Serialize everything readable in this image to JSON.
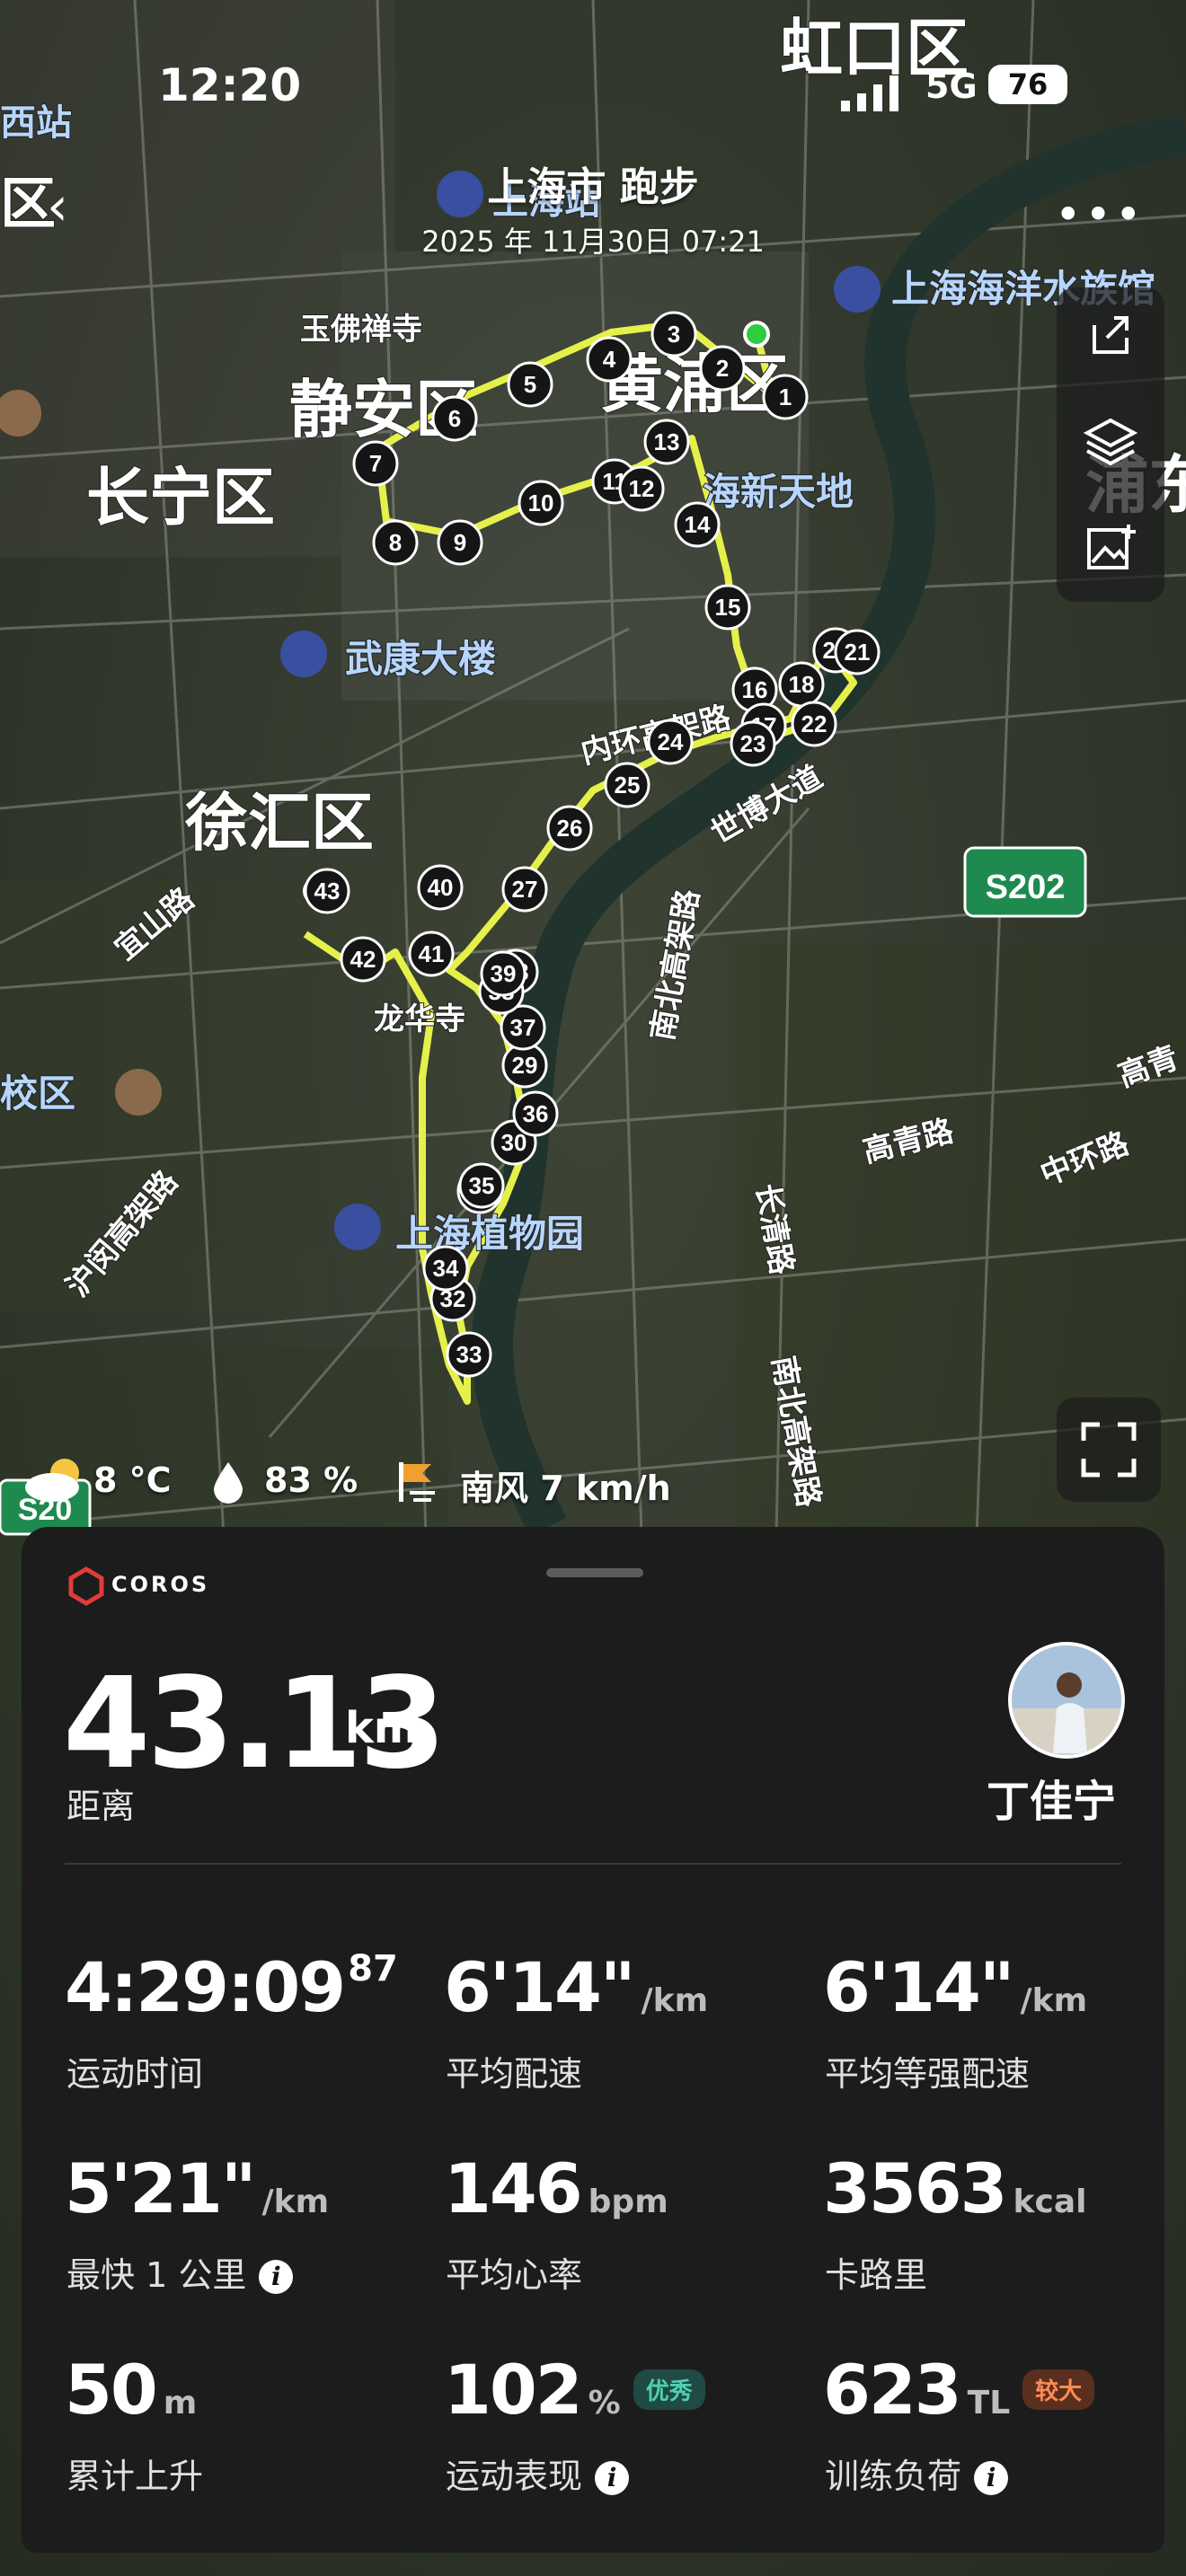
{
  "status_bar": {
    "time": "12:20",
    "network": "5G",
    "battery": "76"
  },
  "header": {
    "title": "上海市 跑步",
    "datetime": "2025 年 11月30日 07:21"
  },
  "map": {
    "labels": [
      "虹口区",
      "西站",
      "区",
      "玉佛禅寺",
      "上海站",
      "上海海洋水族馆",
      "静安区",
      "黄浦区",
      "长宁区",
      "海新天地",
      "武康大楼",
      "内环高架路",
      "徐汇区",
      "宜山路",
      "世博大道",
      "S202",
      "龙华寺",
      "校区",
      "南北高架路",
      "长清路",
      "高青路",
      "中环路",
      "沪闵高架路",
      "上海植物园",
      "南北高架路",
      "S20",
      "浦东",
      "高青"
    ],
    "km_markers": [
      "1",
      "2",
      "3",
      "4",
      "5",
      "6",
      "7",
      "8",
      "9",
      "10",
      "11",
      "12",
      "13",
      "14",
      "15",
      "16",
      "17",
      "18",
      "20",
      "21",
      "22",
      "23",
      "24",
      "25",
      "26",
      "27",
      "28",
      "29",
      "30",
      "31",
      "32",
      "33",
      "34",
      "35",
      "36",
      "37",
      "38",
      "39",
      "40",
      "41",
      "42",
      "43"
    ]
  },
  "weather": {
    "temperature": "8 °C",
    "humidity": "83 %",
    "wind": "南风 7 km/h"
  },
  "panel": {
    "brand": "COROS",
    "distance": {
      "value": "43.13",
      "unit": "km",
      "label": "距离"
    },
    "user": {
      "name": "丁佳宁"
    },
    "stats": [
      {
        "value": "4:29:09",
        "sup": "87",
        "unit": "",
        "label": "运动时间"
      },
      {
        "value": "6'14\"",
        "unit": "/km",
        "label": "平均配速"
      },
      {
        "value": "6'14\"",
        "unit": "/km",
        "label": "平均等强配速"
      },
      {
        "value": "5'21\"",
        "unit": "/km",
        "label": "最快 1 公里"
      },
      {
        "value": "146",
        "unit": "bpm",
        "label": "平均心率"
      },
      {
        "value": "3563",
        "unit": "kcal",
        "label": "卡路里"
      },
      {
        "value": "50",
        "unit": "m",
        "label": "累计上升"
      },
      {
        "value": "102",
        "unit": "%",
        "badge": "优秀",
        "label": "运动表现"
      },
      {
        "value": "623",
        "unit": "TL",
        "badge": "较大",
        "label": "训练负荷"
      }
    ]
  },
  "colors": {
    "route": "#e6f04a",
    "start": "#2ecc40",
    "end": "#e8101e",
    "panel": "#1c1c1c",
    "good_badge": "#4fd0b0",
    "high_badge": "#ff8a55"
  }
}
